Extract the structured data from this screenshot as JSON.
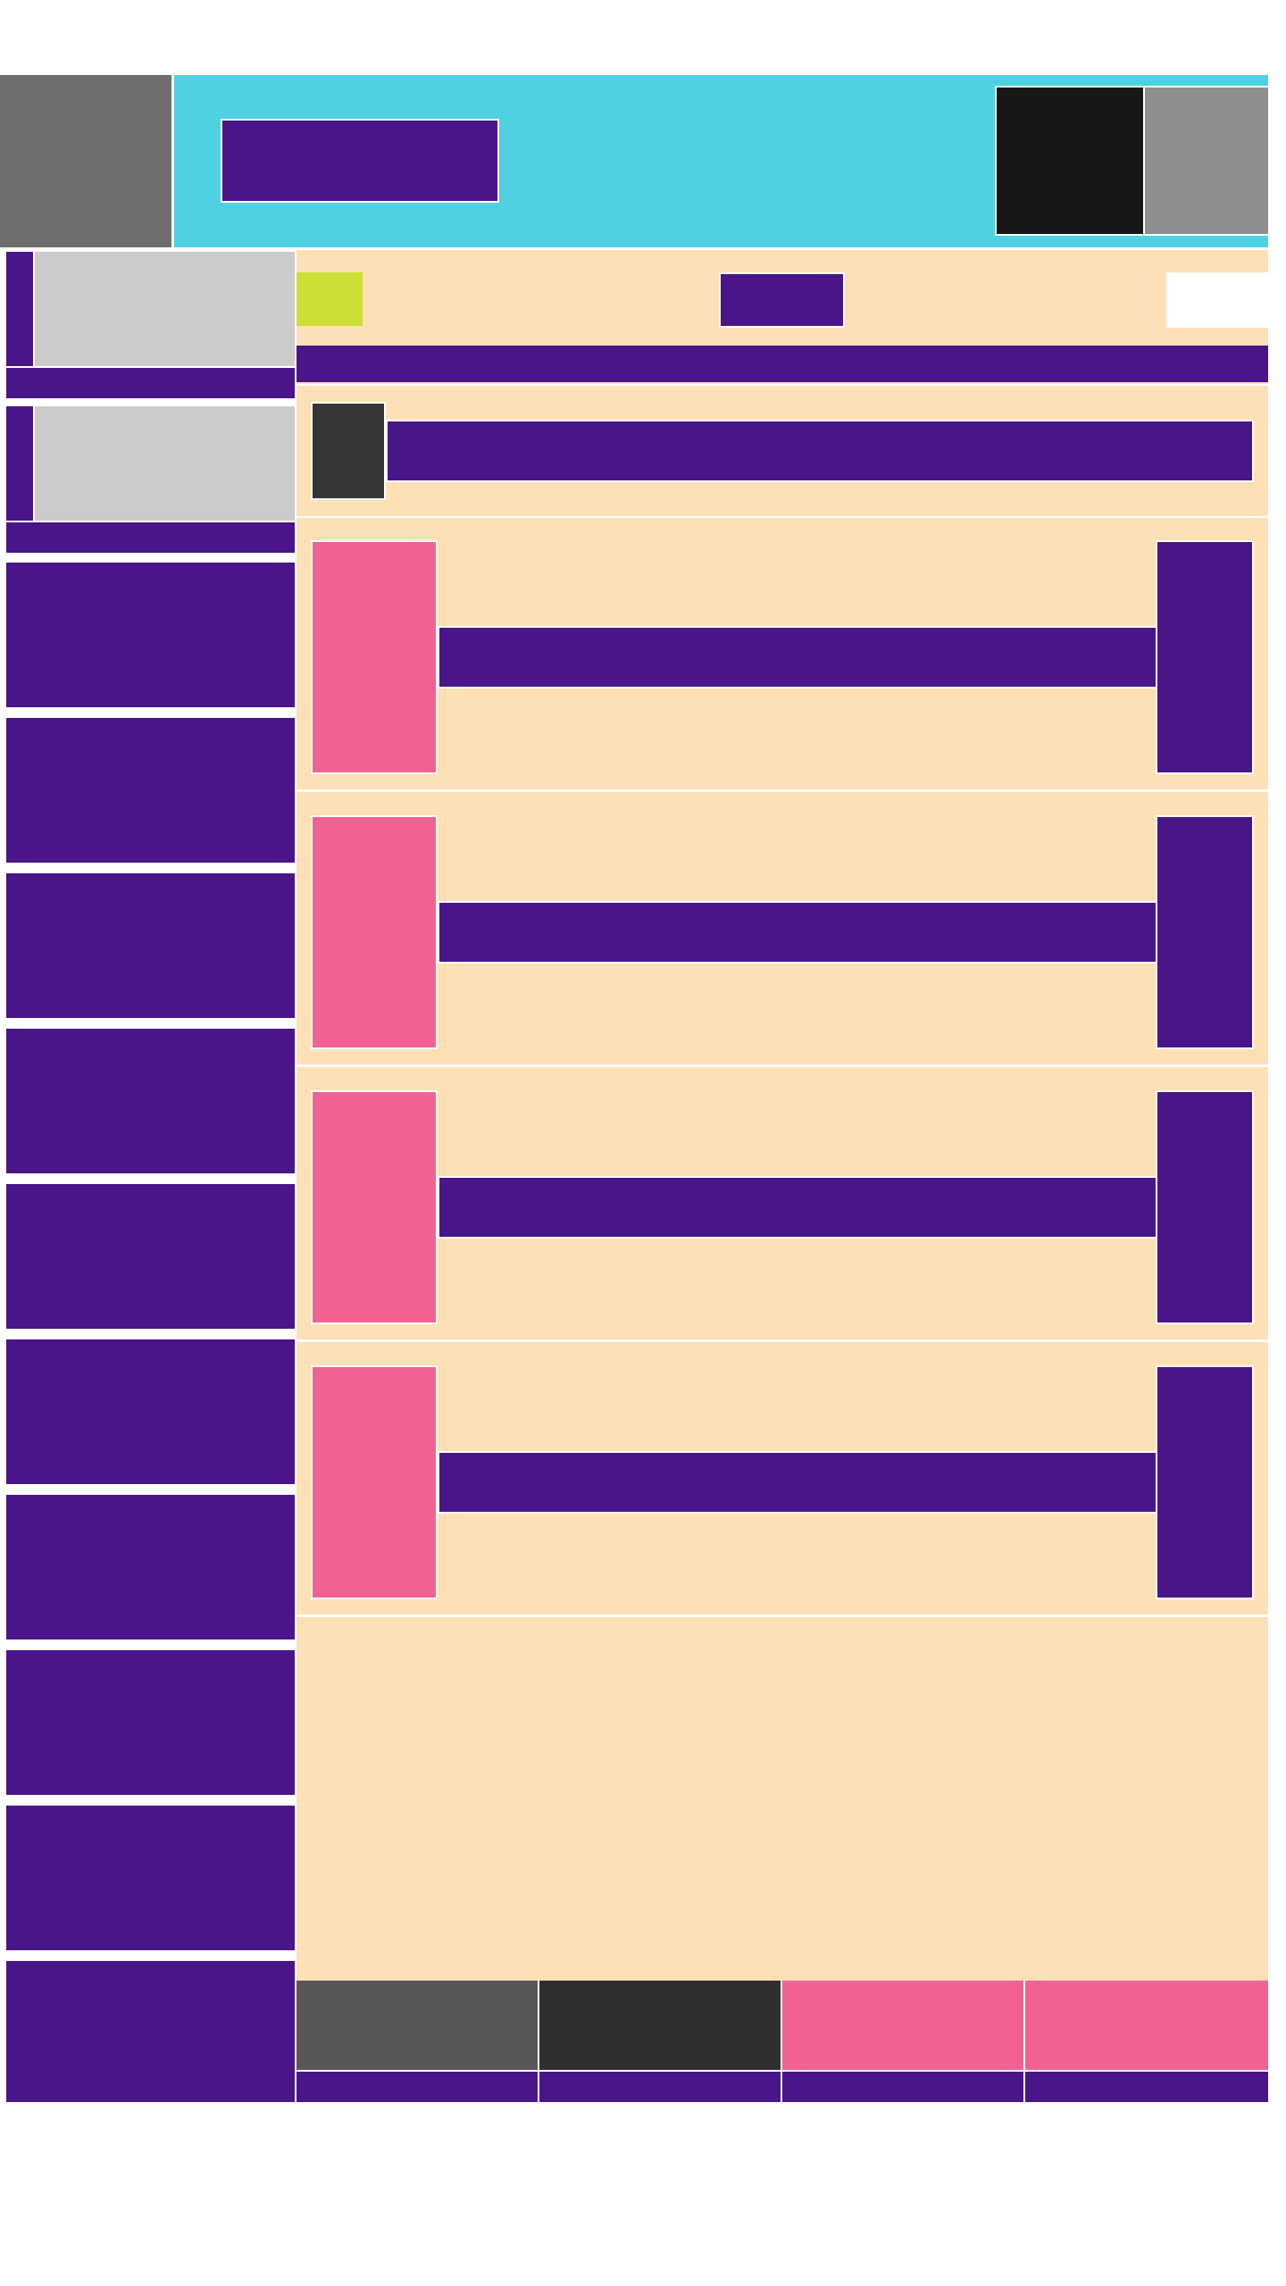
{
  "colors": {
    "topbar_left": "#6e6e6e",
    "topbar": "#4fd1e2",
    "purple": "#4a1589",
    "pink": "#f06292",
    "peach": "#fde0b5",
    "lightgray": "#cbcbcb",
    "darkgray": "#363636",
    "black": "#171717",
    "midgray": "#8e8e8e",
    "lime": "#cddf37",
    "white": "#ffffff",
    "tab_gray": "#575757",
    "tab_dark": "#2f2f2f"
  },
  "icons": {
    "top_left_tile": "placeholder-tile-icon",
    "top_right_dark_tile": "placeholder-tile-icon",
    "top_right_gray_tile": "placeholder-tile-icon",
    "header_dark_tile": "placeholder-tile-icon"
  },
  "header": {
    "title": "",
    "logo_alt": ""
  },
  "toolbar": {
    "left_badge": "",
    "center_button": "",
    "right_input_value": "",
    "banner_text": ""
  },
  "hero": {
    "title": ""
  },
  "sidebar": {
    "cards": [
      {
        "label": ""
      },
      {
        "label": ""
      }
    ],
    "items": [
      {
        "label": ""
      },
      {
        "label": ""
      },
      {
        "label": ""
      },
      {
        "label": ""
      },
      {
        "label": ""
      },
      {
        "label": ""
      },
      {
        "label": ""
      },
      {
        "label": ""
      },
      {
        "label": ""
      },
      {
        "label": ""
      }
    ]
  },
  "rows": [
    {
      "title": "",
      "action": ""
    },
    {
      "title": "",
      "action": ""
    },
    {
      "title": "",
      "action": ""
    },
    {
      "title": "",
      "action": ""
    }
  ],
  "bottom_tabs": [
    {
      "label": ""
    },
    {
      "label": ""
    },
    {
      "label": ""
    },
    {
      "label": ""
    }
  ]
}
